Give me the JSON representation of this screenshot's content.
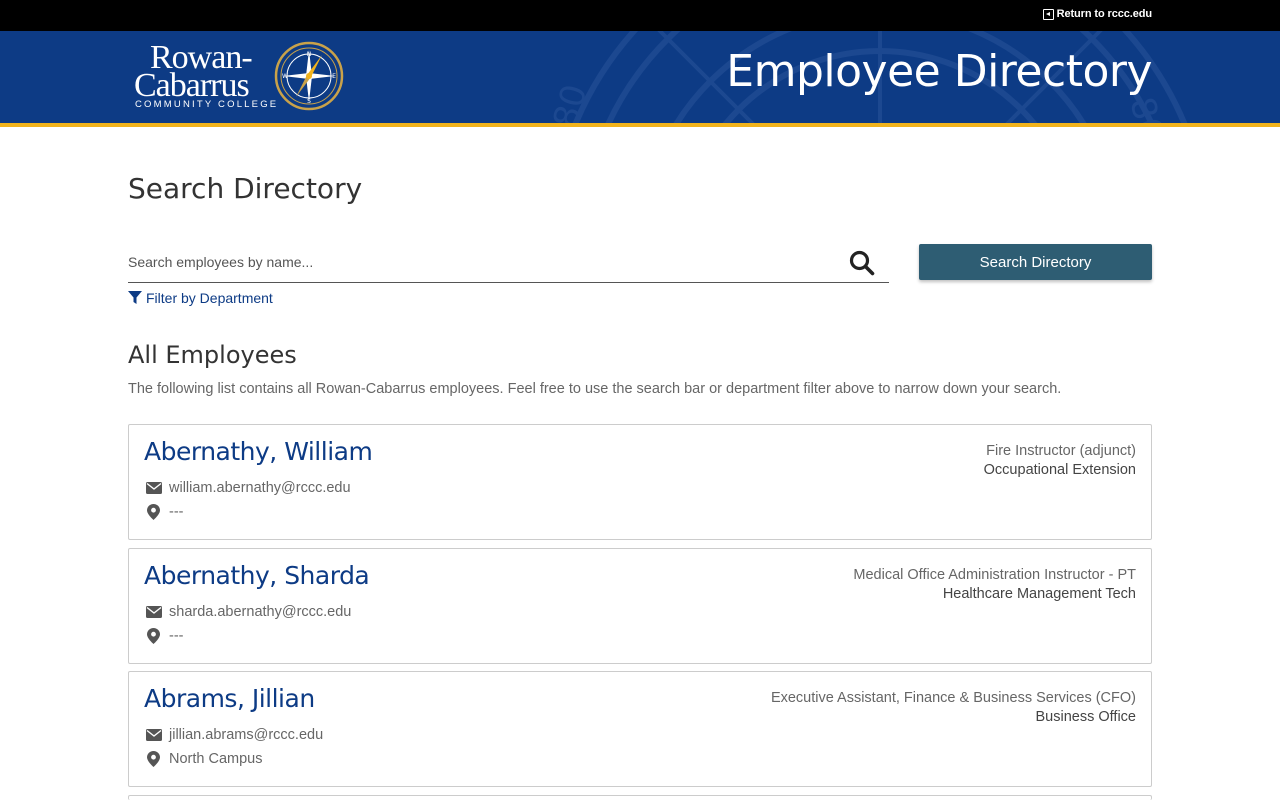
{
  "topbar": {
    "return_label": "Return to rccc.edu"
  },
  "header": {
    "logo_line1": "Rowan-",
    "logo_line2": "Cabarrus",
    "logo_line3": "COMMUNITY COLLEGE",
    "title": "Employee Directory"
  },
  "search": {
    "heading": "Search Directory",
    "placeholder": "Search employees by name...",
    "button_label": "Search Directory",
    "filter_label": "Filter by Department"
  },
  "employees_section": {
    "heading": "All Employees",
    "description": "The following list contains all Rowan-Cabarrus employees. Feel free to use the search bar or department filter above to narrow down your search."
  },
  "employees": [
    {
      "name": "Abernathy, William",
      "email": "william.abernathy@rccc.edu",
      "location": "---",
      "title": "Fire Instructor (adjunct)",
      "department": "Occupational Extension"
    },
    {
      "name": "Abernathy, Sharda",
      "email": "sharda.abernathy@rccc.edu",
      "location": "---",
      "title": "Medical Office Administration Instructor - PT",
      "department": "Healthcare Management Tech"
    },
    {
      "name": "Abrams, Jillian",
      "email": "jillian.abrams@rccc.edu",
      "location": "North Campus",
      "title": "Executive Assistant, Finance & Business Services (CFO)",
      "department": "Business Office"
    }
  ],
  "colors": {
    "brand_blue": "#0d3b85",
    "accent_gold": "#f1b31c",
    "button_teal": "#2e5d73"
  }
}
